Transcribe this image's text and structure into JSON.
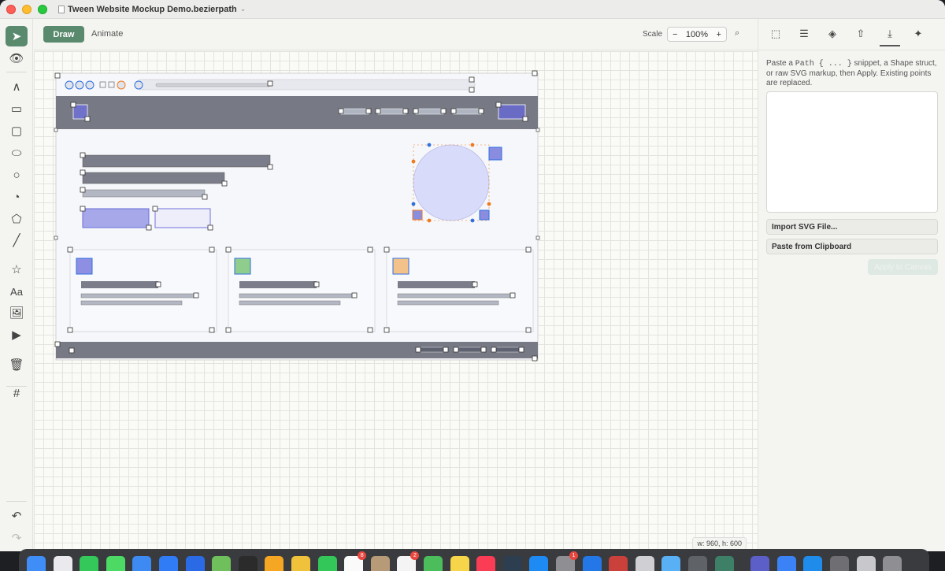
{
  "window": {
    "title": "Tween Website Mockup Demo.bezierpath",
    "title_chevron": "⌄"
  },
  "toolbar": {
    "tools": [
      {
        "name": "pointer-tool",
        "icon": "pointer-icon",
        "glyph": "➤",
        "active": true
      },
      {
        "name": "preview-tool",
        "icon": "eye-icon",
        "glyph": "👁"
      },
      {
        "name": "pen-tool",
        "icon": "pen-icon",
        "glyph": "∧"
      },
      {
        "name": "rectangle-tool",
        "icon": "rectangle-icon",
        "glyph": "▭"
      },
      {
        "name": "rounded-rect-tool",
        "icon": "rounded-rect-icon",
        "glyph": "▢"
      },
      {
        "name": "ellipse-tool",
        "icon": "ellipse-icon",
        "glyph": "⬭"
      },
      {
        "name": "circle-tool",
        "icon": "circle-icon",
        "glyph": "○"
      },
      {
        "name": "pie-tool",
        "icon": "pie-icon",
        "glyph": "◔"
      },
      {
        "name": "polygon-tool",
        "icon": "pentagon-icon",
        "glyph": "⬠"
      },
      {
        "name": "line-tool",
        "icon": "line-icon",
        "glyph": "╱"
      },
      {
        "name": "star-tool",
        "icon": "star-icon",
        "glyph": "☆"
      },
      {
        "name": "text-tool",
        "icon": "text-icon",
        "glyph": "Aa"
      },
      {
        "name": "image-tool",
        "icon": "image-icon",
        "glyph": "🖼"
      },
      {
        "name": "video-tool",
        "icon": "video-icon",
        "glyph": "▶"
      },
      {
        "name": "delete-tool",
        "icon": "trash-icon",
        "glyph": "🗑"
      },
      {
        "name": "grid-tool",
        "icon": "grid-icon",
        "glyph": "#"
      }
    ],
    "undo_glyph": "↶",
    "redo_glyph": "↷"
  },
  "modebar": {
    "draw_label": "Draw",
    "animate_label": "Animate",
    "scale_label": "Scale",
    "zoom_out": "−",
    "zoom_value": "100%",
    "zoom_in": "+",
    "zoom_glyph": "⌕"
  },
  "canvas": {
    "dimensions_label": "w: 960, h: 600"
  },
  "panel": {
    "icons": [
      {
        "name": "selection-icon",
        "glyph": "⬚"
      },
      {
        "name": "sliders-icon",
        "glyph": "☰"
      },
      {
        "name": "layers-icon",
        "glyph": "◈"
      },
      {
        "name": "share-icon",
        "glyph": "⇧"
      },
      {
        "name": "import-icon",
        "glyph": "⤓",
        "active": true
      },
      {
        "name": "sparkle-icon",
        "glyph": "✦"
      }
    ],
    "help_before": "Paste a ",
    "help_code1": "Path { ... }",
    "help_after": " snippet, a Shape struct, or raw SVG markup, then Apply. Existing points are replaced.",
    "import_svg_label": "Import SVG File...",
    "paste_clipboard_label": "Paste from Clipboard",
    "apply_label": "Apply to Canvas"
  },
  "dock": {
    "apps": [
      {
        "name": "finder",
        "color": "#3f8ef7"
      },
      {
        "name": "launchpad",
        "color": "#e9e9ee"
      },
      {
        "name": "whatsapp",
        "color": "#34c759"
      },
      {
        "name": "messages",
        "color": "#4cd964"
      },
      {
        "name": "mail",
        "color": "#3d8bf2"
      },
      {
        "name": "safari",
        "color": "#2f7cf6"
      },
      {
        "name": "app-store-connect",
        "color": "#2a6be5"
      },
      {
        "name": "maps",
        "color": "#6fbf5d"
      },
      {
        "name": "terminal",
        "color": "#2b2b2b"
      },
      {
        "name": "photos",
        "color": "#f5a623"
      },
      {
        "name": "pencil",
        "color": "#f0c23c"
      },
      {
        "name": "facetime",
        "color": "#33c759"
      },
      {
        "name": "calendar",
        "color": "#fafafa",
        "badge": "8"
      },
      {
        "name": "contacts",
        "color": "#b79b78"
      },
      {
        "name": "reminders",
        "color": "#f4f4f4",
        "badge": "2"
      },
      {
        "name": "numbers",
        "color": "#4cbd5b"
      },
      {
        "name": "notes",
        "color": "#f7d54a"
      },
      {
        "name": "music",
        "color": "#fa3d55"
      },
      {
        "name": "layers",
        "color": "#2c3e50"
      },
      {
        "name": "app-store",
        "color": "#1d8bf3"
      },
      {
        "name": "settings",
        "color": "#8e8e93",
        "badge": "1"
      },
      {
        "name": "xcode",
        "color": "#2377e6"
      },
      {
        "name": "photo-booth",
        "color": "#c9413a"
      },
      {
        "name": "printer",
        "color": "#d0d0d4"
      },
      {
        "name": "quicktime",
        "color": "#5ab0f5"
      },
      {
        "name": "help",
        "color": "#5f6368"
      },
      {
        "name": "tween",
        "color": "#3e7f68"
      },
      {
        "name": "teams",
        "color": "#5b5fc7"
      },
      {
        "name": "files",
        "color": "#3b82f6"
      },
      {
        "name": "docker",
        "color": "#1f8ceb"
      },
      {
        "name": "disk",
        "color": "#6e6e73"
      },
      {
        "name": "downloads",
        "color": "#c7c7cc"
      },
      {
        "name": "trash",
        "color": "#8e8e93"
      }
    ]
  }
}
